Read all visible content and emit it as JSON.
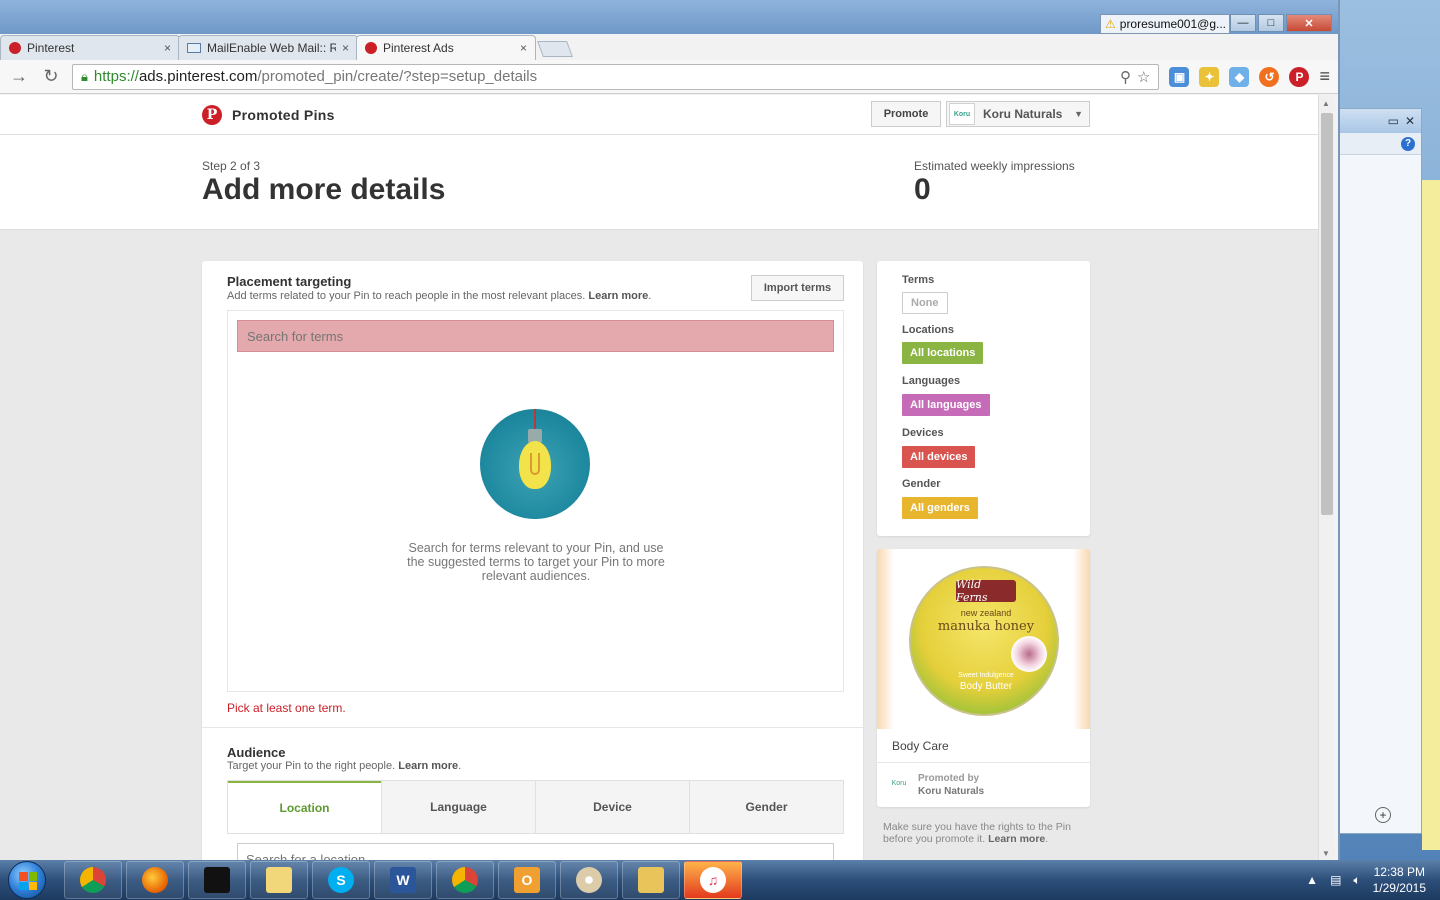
{
  "browser": {
    "tabs": [
      {
        "label": "Pinterest",
        "icon": "pinterest-icon",
        "active": false
      },
      {
        "label": "MailEnable Web Mail:: RE",
        "icon": "mail-icon",
        "active": false
      },
      {
        "label": "Pinterest Ads",
        "icon": "pinterest-icon",
        "active": true
      }
    ],
    "tab_close": "×",
    "profile_name": "proresume001@g...",
    "url": {
      "scheme": "https://",
      "host": "ads.pinterest.com",
      "path": "/promoted_pin/create/?step=setup_details"
    },
    "controls": {
      "minimize": "—",
      "maximize": "□",
      "close": "✕"
    }
  },
  "header": {
    "brand_logo": "P",
    "title": "Promoted Pins",
    "promote_label": "Promote",
    "account_logo": "Koru",
    "account_name": "Koru Naturals"
  },
  "step": {
    "label": "Step 2 of 3",
    "title": "Add more details",
    "estimate_label": "Estimated weekly impressions",
    "estimate_value": "0"
  },
  "placement": {
    "title": "Placement targeting",
    "subtitle": "Add terms related to your Pin to reach people in the most relevant places.",
    "learn_more": "Learn more",
    "subtitle_end": ".",
    "import_label": "Import terms",
    "search_placeholder": "Search for terms",
    "hint": "Search for terms relevant to your Pin, and use the suggested terms to target your Pin to more relevant audiences.",
    "error": "Pick at least one term."
  },
  "audience": {
    "title": "Audience",
    "subtitle": "Target your Pin to the right people.",
    "learn_more": "Learn more",
    "subtitle_end": ".",
    "tabs": [
      "Location",
      "Language",
      "Device",
      "Gender"
    ],
    "active_tab": 0,
    "search_placeholder": "Search for a location"
  },
  "summary": {
    "terms_label": "Terms",
    "terms_value": "None",
    "locations_label": "Locations",
    "locations_value": "All locations",
    "languages_label": "Languages",
    "languages_value": "All languages",
    "devices_label": "Devices",
    "devices_value": "All devices",
    "gender_label": "Gender",
    "gender_value": "All genders"
  },
  "pin": {
    "jar_brand": "Wild Ferns",
    "jar_line1": "new zealand",
    "jar_line2": "manuka honey",
    "jar_line3": "Sweet Indulgence",
    "jar_line4": "Body Butter",
    "category": "Body Care",
    "promoted_by": "Promoted by",
    "promoter": "Koru Naturals",
    "promoter_logo": "Koru"
  },
  "rights_note": {
    "text": "Make sure you have the rights to the Pin before you promote it.",
    "learn_more": "Learn more",
    "end": "."
  },
  "taskbar": {
    "apps": [
      "chrome-icon",
      "firefox-icon",
      "fitbit-icon",
      "folder-icon",
      "skype-icon",
      "word-icon",
      "chrome-icon",
      "outlook-icon",
      "paint-icon",
      "explorer-icon",
      "itunes-icon"
    ],
    "time": "12:38 PM",
    "date": "1/29/2015"
  },
  "colors": {
    "pinterest_red": "#cb2027",
    "green": "#8ab542",
    "pink": "#c56bb8",
    "red": "#d9534f",
    "yellow": "#e8b52f"
  }
}
